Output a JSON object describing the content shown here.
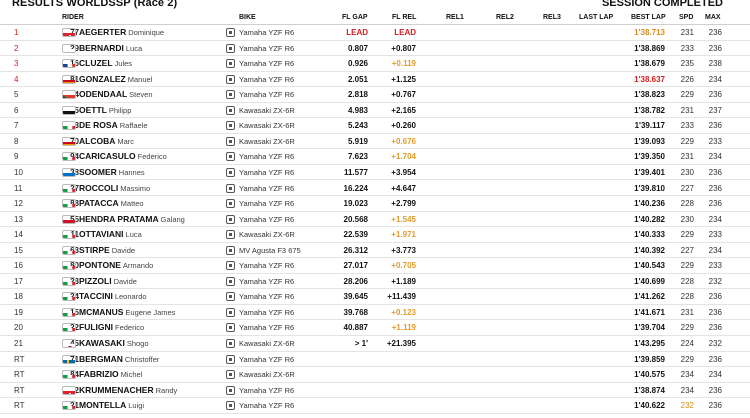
{
  "header": {
    "title": "RESULTS WORLDSSP  (Race 2)",
    "status": "SESSION COMPLETED"
  },
  "columns": {
    "rider": "RIDER",
    "bike": "BIKE",
    "fl_gap": "FL GAP",
    "fl_rel": "FL REL",
    "rel1": "REL1",
    "rel2": "REL2",
    "rel3": "REL3",
    "last_lap": "LAST LAP",
    "best_lap": "BEST LAP",
    "spd": "SPD",
    "max": "MAX"
  },
  "colors": {
    "lead": "#d42020",
    "sector_best": "#e39c2a",
    "best_lap_gold": "#d98f18"
  },
  "rows": [
    {
      "pos": "1",
      "pos_color": "red",
      "num": "77",
      "flag": "switzerland",
      "last": "AEGERTER",
      "first": "Dominique",
      "bike": "Yamaha YZF R6",
      "fl_gap": "LEAD",
      "fl_gap_color": "red",
      "fl_rel": "LEAD",
      "fl_rel_color": "red",
      "best": "1'38.713",
      "best_color": "gold",
      "spd": "231",
      "spd_color": "",
      "max": "236"
    },
    {
      "pos": "2",
      "pos_color": "red",
      "num": "29",
      "flag": "san-marino",
      "last": "BERNARDI",
      "first": "Luca",
      "bike": "Yamaha YZF R6",
      "fl_gap": "0.807",
      "fl_gap_color": "",
      "fl_rel": "+0.807",
      "fl_rel_color": "",
      "best": "1'38.869",
      "best_color": "",
      "spd": "233",
      "spd_color": "",
      "max": "236"
    },
    {
      "pos": "3",
      "pos_color": "red",
      "num": "16",
      "flag": "france",
      "last": "CLUZEL",
      "first": "Jules",
      "bike": "Yamaha YZF R6",
      "fl_gap": "0.926",
      "fl_gap_color": "",
      "fl_rel": "+0.119",
      "fl_rel_color": "orange",
      "best": "1'38.679",
      "best_color": "",
      "spd": "235",
      "spd_color": "",
      "max": "238"
    },
    {
      "pos": "4",
      "pos_color": "red",
      "num": "81",
      "flag": "spain",
      "last": "GONZALEZ",
      "first": "Manuel",
      "bike": "Yamaha YZF R6",
      "fl_gap": "2.051",
      "fl_gap_color": "",
      "fl_rel": "+1.125",
      "fl_rel_color": "",
      "best": "1'38.637",
      "best_color": "red",
      "spd": "226",
      "spd_color": "",
      "max": "234"
    },
    {
      "pos": "5",
      "pos_color": "",
      "num": "4",
      "flag": "south-africa",
      "last": "ODENDAAL",
      "first": "Steven",
      "bike": "Yamaha YZF R6",
      "fl_gap": "2.818",
      "fl_gap_color": "",
      "fl_rel": "+0.767",
      "fl_rel_color": "",
      "best": "1'38.823",
      "best_color": "",
      "spd": "229",
      "spd_color": "",
      "max": "236"
    },
    {
      "pos": "6",
      "pos_color": "",
      "num": "5",
      "flag": "germany",
      "last": "OETTL",
      "first": "Philipp",
      "bike": "Kawasaki ZX-6R",
      "fl_gap": "4.983",
      "fl_gap_color": "",
      "fl_rel": "+2.165",
      "fl_rel_color": "",
      "best": "1'38.782",
      "best_color": "",
      "spd": "231",
      "spd_color": "",
      "max": "237"
    },
    {
      "pos": "7",
      "pos_color": "",
      "num": "3",
      "flag": "italy",
      "last": "DE ROSA",
      "first": "Raffaele",
      "bike": "Kawasaki ZX-6R",
      "fl_gap": "5.243",
      "fl_gap_color": "",
      "fl_rel": "+0.260",
      "fl_rel_color": "",
      "best": "1'39.117",
      "best_color": "",
      "spd": "233",
      "spd_color": "",
      "max": "236"
    },
    {
      "pos": "8",
      "pos_color": "",
      "num": "70",
      "flag": "spain",
      "last": "ALCOBA",
      "first": "Marc",
      "bike": "Kawasaki ZX-6R",
      "fl_gap": "5.919",
      "fl_gap_color": "",
      "fl_rel": "+0.676",
      "fl_rel_color": "orange",
      "best": "1'39.093",
      "best_color": "",
      "spd": "229",
      "spd_color": "",
      "max": "233"
    },
    {
      "pos": "9",
      "pos_color": "",
      "num": "94",
      "flag": "italy",
      "last": "CARICASULO",
      "first": "Federico",
      "bike": "Yamaha YZF R6",
      "fl_gap": "7.623",
      "fl_gap_color": "",
      "fl_rel": "+1.704",
      "fl_rel_color": "orange",
      "best": "1'39.350",
      "best_color": "",
      "spd": "231",
      "spd_color": "",
      "max": "234"
    },
    {
      "pos": "10",
      "pos_color": "",
      "num": "38",
      "flag": "estonia",
      "last": "SOOMER",
      "first": "Hannes",
      "bike": "Yamaha YZF R6",
      "fl_gap": "11.577",
      "fl_gap_color": "",
      "fl_rel": "+3.954",
      "fl_rel_color": "",
      "best": "1'39.401",
      "best_color": "",
      "spd": "230",
      "spd_color": "",
      "max": "236"
    },
    {
      "pos": "11",
      "pos_color": "",
      "num": "27",
      "flag": "italy",
      "last": "ROCCOLI",
      "first": "Massimo",
      "bike": "Yamaha YZF R6",
      "fl_gap": "16.224",
      "fl_gap_color": "",
      "fl_rel": "+4.647",
      "fl_rel_color": "",
      "best": "1'39.810",
      "best_color": "",
      "spd": "227",
      "spd_color": "",
      "max": "236"
    },
    {
      "pos": "12",
      "pos_color": "",
      "num": "88",
      "flag": "italy",
      "last": "PATACCA",
      "first": "Matteo",
      "bike": "Yamaha YZF R6",
      "fl_gap": "19.023",
      "fl_gap_color": "",
      "fl_rel": "+2.799",
      "fl_rel_color": "",
      "best": "1'40.236",
      "best_color": "",
      "spd": "228",
      "spd_color": "",
      "max": "236"
    },
    {
      "pos": "13",
      "pos_color": "",
      "num": "55",
      "flag": "indonesia",
      "last": "HENDRA PRATAMA",
      "first": "Galang",
      "bike": "Yamaha YZF R6",
      "fl_gap": "20.568",
      "fl_gap_color": "",
      "fl_rel": "+1.545",
      "fl_rel_color": "orange",
      "best": "1'40.282",
      "best_color": "",
      "spd": "230",
      "spd_color": "",
      "max": "234"
    },
    {
      "pos": "14",
      "pos_color": "",
      "num": "11",
      "flag": "italy",
      "last": "OTTAVIANI",
      "first": "Luca",
      "bike": "Kawasaki ZX-6R",
      "fl_gap": "22.539",
      "fl_gap_color": "",
      "fl_rel": "+1.971",
      "fl_rel_color": "orange",
      "best": "1'40.333",
      "best_color": "",
      "spd": "229",
      "spd_color": "",
      "max": "233"
    },
    {
      "pos": "15",
      "pos_color": "",
      "num": "63",
      "flag": "italy",
      "last": "STIRPE",
      "first": "Davide",
      "bike": "MV Agusta F3 675",
      "fl_gap": "26.312",
      "fl_gap_color": "",
      "fl_rel": "+3.773",
      "fl_rel_color": "",
      "best": "1'40.392",
      "best_color": "",
      "spd": "227",
      "spd_color": "",
      "max": "234"
    },
    {
      "pos": "16",
      "pos_color": "",
      "num": "80",
      "flag": "italy",
      "last": "PONTONE",
      "first": "Armando",
      "bike": "Yamaha YZF R6",
      "fl_gap": "27.017",
      "fl_gap_color": "",
      "fl_rel": "+0.705",
      "fl_rel_color": "orange",
      "best": "1'40.543",
      "best_color": "",
      "spd": "229",
      "spd_color": "",
      "max": "233"
    },
    {
      "pos": "17",
      "pos_color": "",
      "num": "23",
      "flag": "italy",
      "last": "PIZZOLI",
      "first": "Davide",
      "bike": "Yamaha YZF R6",
      "fl_gap": "28.206",
      "fl_gap_color": "",
      "fl_rel": "+1.189",
      "fl_rel_color": "",
      "best": "1'40.699",
      "best_color": "",
      "spd": "228",
      "spd_color": "",
      "max": "232"
    },
    {
      "pos": "18",
      "pos_color": "",
      "num": "24",
      "flag": "italy",
      "last": "TACCINI",
      "first": "Leonardo",
      "bike": "Yamaha YZF R6",
      "fl_gap": "39.645",
      "fl_gap_color": "",
      "fl_rel": "+11.439",
      "fl_rel_color": "",
      "best": "1'41.262",
      "best_color": "",
      "spd": "228",
      "spd_color": "",
      "max": "236"
    },
    {
      "pos": "19",
      "pos_color": "",
      "num": "15",
      "flag": "italy",
      "last": "MCMANUS",
      "first": "Eugene James",
      "bike": "Yamaha YZF R6",
      "fl_gap": "39.768",
      "fl_gap_color": "",
      "fl_rel": "+0.123",
      "fl_rel_color": "orange",
      "best": "1'41.671",
      "best_color": "",
      "spd": "231",
      "spd_color": "",
      "max": "236"
    },
    {
      "pos": "20",
      "pos_color": "",
      "num": "22",
      "flag": "italy",
      "last": "FULIGNI",
      "first": "Federico",
      "bike": "Yamaha YZF R6",
      "fl_gap": "40.887",
      "fl_gap_color": "",
      "fl_rel": "+1.119",
      "fl_rel_color": "orange",
      "best": "1'39.704",
      "best_color": "",
      "spd": "229",
      "spd_color": "",
      "max": "236"
    },
    {
      "pos": "21",
      "pos_color": "",
      "num": "45",
      "flag": "japan",
      "last": "KAWASAKI",
      "first": "Shogo",
      "bike": "Kawasaki ZX-6R",
      "fl_gap": "> 1'",
      "fl_gap_color": "",
      "fl_rel": "+21.395",
      "fl_rel_color": "",
      "best": "1'43.295",
      "best_color": "",
      "spd": "224",
      "spd_color": "",
      "max": "232"
    },
    {
      "pos": "RT",
      "pos_color": "",
      "num": "71",
      "flag": "sweden",
      "last": "BERGMAN",
      "first": "Christoffer",
      "bike": "Yamaha YZF R6",
      "fl_gap": "",
      "fl_gap_color": "",
      "fl_rel": "",
      "fl_rel_color": "",
      "best": "1'39.859",
      "best_color": "",
      "spd": "229",
      "spd_color": "",
      "max": "236"
    },
    {
      "pos": "RT",
      "pos_color": "",
      "num": "84",
      "flag": "italy",
      "last": "FABRIZIO",
      "first": "Michel",
      "bike": "Kawasaki ZX-6R",
      "fl_gap": "",
      "fl_gap_color": "",
      "fl_rel": "",
      "fl_rel_color": "",
      "best": "1'40.575",
      "best_color": "",
      "spd": "234",
      "spd_color": "",
      "max": "234"
    },
    {
      "pos": "RT",
      "pos_color": "",
      "num": "2",
      "flag": "switzerland",
      "last": "KRUMMENACHER",
      "first": "Randy",
      "bike": "Yamaha YZF R6",
      "fl_gap": "",
      "fl_gap_color": "",
      "fl_rel": "",
      "fl_rel_color": "",
      "best": "1'38.874",
      "best_color": "",
      "spd": "234",
      "spd_color": "",
      "max": "236"
    },
    {
      "pos": "RT",
      "pos_color": "",
      "num": "21",
      "flag": "italy",
      "last": "MONTELLA",
      "first": "Luigi",
      "bike": "Yamaha YZF R6",
      "fl_gap": "",
      "fl_gap_color": "",
      "fl_rel": "",
      "fl_rel_color": "",
      "best": "1'40.622",
      "best_color": "",
      "spd": "232",
      "spd_color": "gold",
      "max": "236"
    }
  ]
}
